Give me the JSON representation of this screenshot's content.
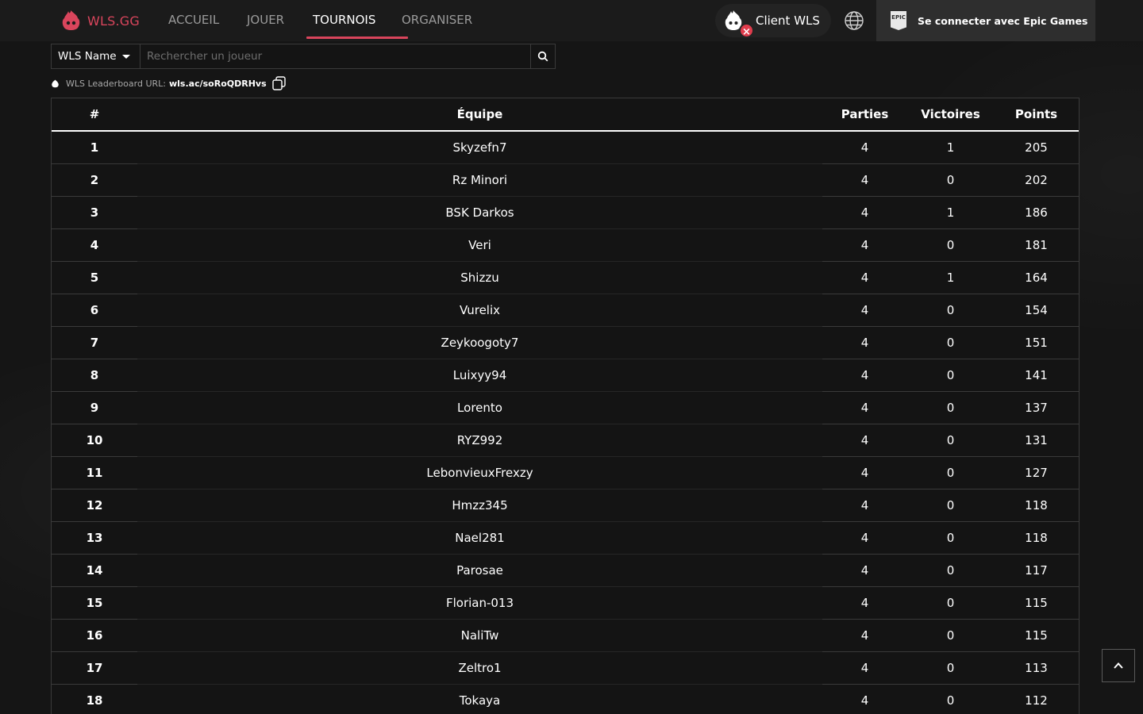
{
  "brand": {
    "name": "WLS.GG",
    "accent": "#d9455c"
  },
  "nav": {
    "items": [
      {
        "label": "ACCUEIL",
        "active": false
      },
      {
        "label": "JOUER",
        "active": false
      },
      {
        "label": "TOURNOIS",
        "active": true
      },
      {
        "label": "ORGANISER",
        "active": false
      }
    ]
  },
  "client": {
    "label": "Client WLS",
    "status_icon": "x-icon"
  },
  "language": {
    "icon": "globe-icon"
  },
  "login": {
    "label": "Se connecter avec Epic Games",
    "icon": "epic-games-icon"
  },
  "search": {
    "filter": "WLS Name",
    "placeholder": "Rechercher un joueur",
    "value": ""
  },
  "leaderboard_url": {
    "label": "WLS Leaderboard URL:",
    "value": "wls.ac/soRoQDRHvs"
  },
  "table": {
    "headers": {
      "rank": "#",
      "team": "Équipe",
      "games": "Parties",
      "wins": "Victoires",
      "points": "Points"
    },
    "rows": [
      {
        "rank": "1",
        "team": "Skyzefn7",
        "games": "4",
        "wins": "1",
        "points": "205"
      },
      {
        "rank": "2",
        "team": "Rz Minori",
        "games": "4",
        "wins": "0",
        "points": "202"
      },
      {
        "rank": "3",
        "team": "BSK Darkos",
        "games": "4",
        "wins": "1",
        "points": "186"
      },
      {
        "rank": "4",
        "team": "Veri",
        "games": "4",
        "wins": "0",
        "points": "181"
      },
      {
        "rank": "5",
        "team": "Shizzu",
        "games": "4",
        "wins": "1",
        "points": "164"
      },
      {
        "rank": "6",
        "team": "Vurelix",
        "games": "4",
        "wins": "0",
        "points": "154"
      },
      {
        "rank": "7",
        "team": "Zeykoogoty7",
        "games": "4",
        "wins": "0",
        "points": "151"
      },
      {
        "rank": "8",
        "team": "Luixyy94",
        "games": "4",
        "wins": "0",
        "points": "141"
      },
      {
        "rank": "9",
        "team": "Lorento",
        "games": "4",
        "wins": "0",
        "points": "137"
      },
      {
        "rank": "10",
        "team": "RYZ992",
        "games": "4",
        "wins": "0",
        "points": "131"
      },
      {
        "rank": "11",
        "team": "LebonvieuxFrexzy",
        "games": "4",
        "wins": "0",
        "points": "127"
      },
      {
        "rank": "12",
        "team": "Hmzz345",
        "games": "4",
        "wins": "0",
        "points": "118"
      },
      {
        "rank": "13",
        "team": "Nael281",
        "games": "4",
        "wins": "0",
        "points": "118"
      },
      {
        "rank": "14",
        "team": "Parosae",
        "games": "4",
        "wins": "0",
        "points": "117"
      },
      {
        "rank": "15",
        "team": "Florian-013",
        "games": "4",
        "wins": "0",
        "points": "115"
      },
      {
        "rank": "16",
        "team": "NaliTw",
        "games": "4",
        "wins": "0",
        "points": "115"
      },
      {
        "rank": "17",
        "team": "Zeltro1",
        "games": "4",
        "wins": "0",
        "points": "113"
      },
      {
        "rank": "18",
        "team": "Tokaya",
        "games": "4",
        "wins": "0",
        "points": "112"
      }
    ]
  }
}
